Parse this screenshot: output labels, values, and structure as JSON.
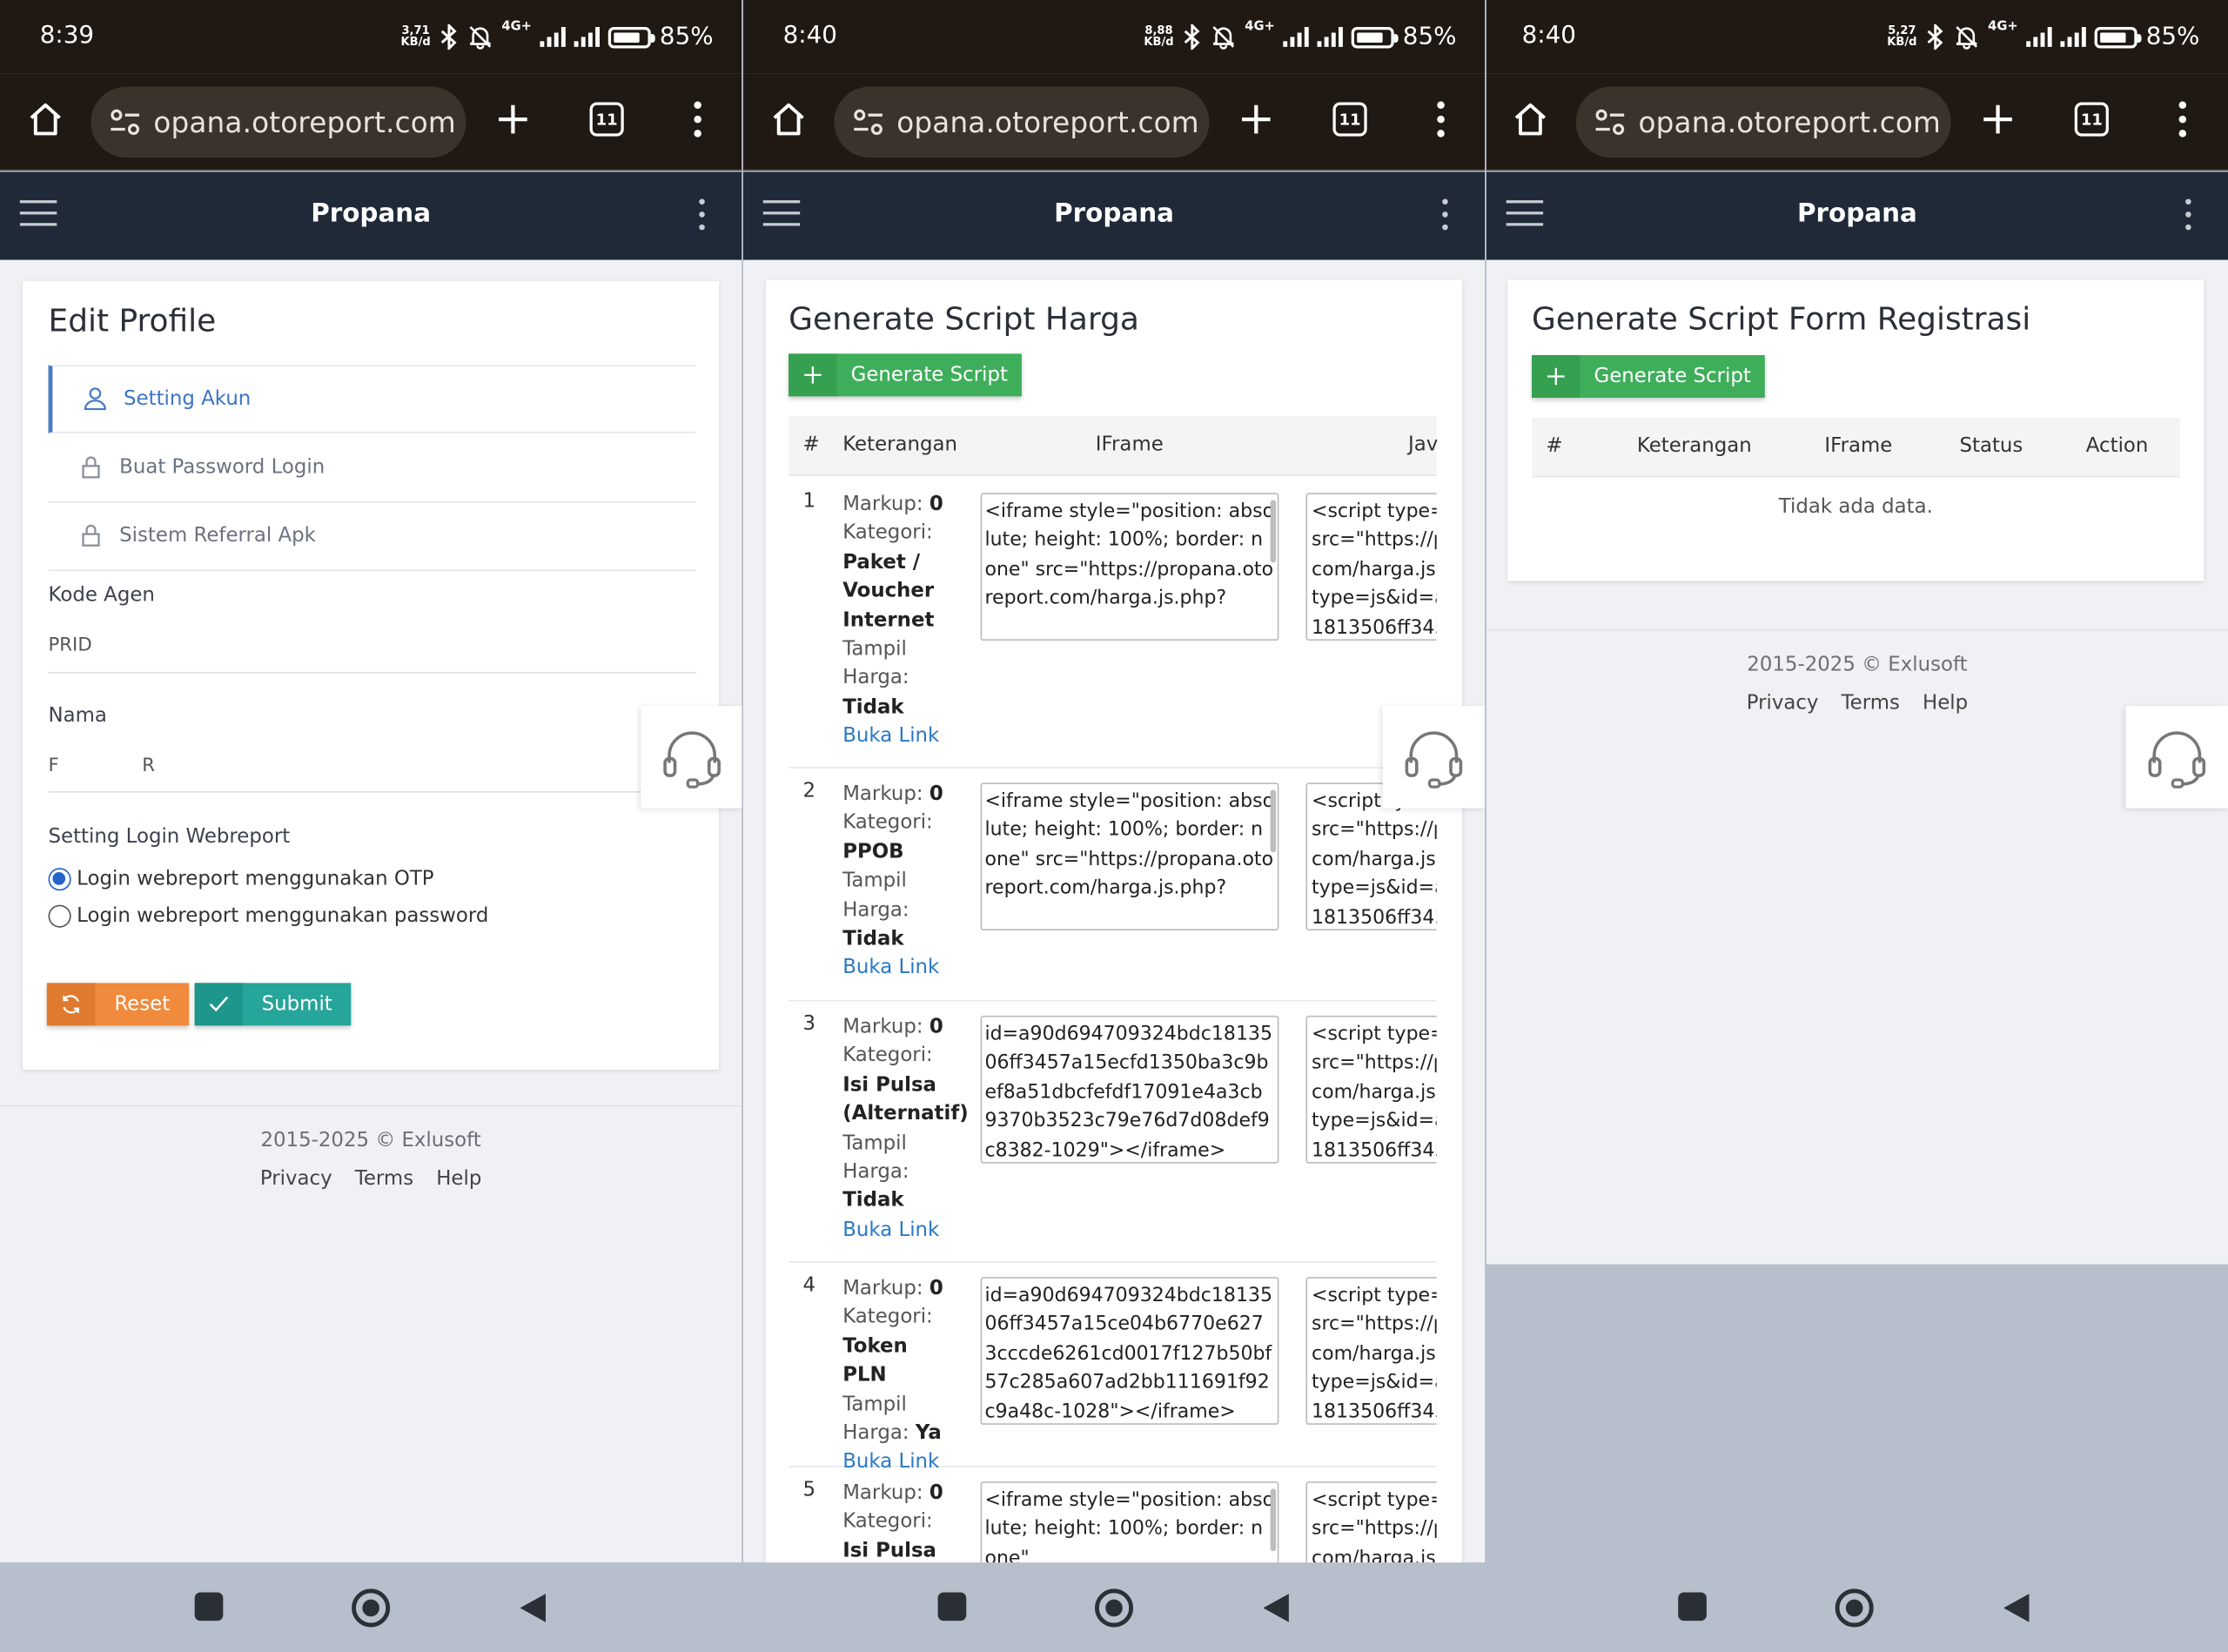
{
  "status": {
    "p1": {
      "time": "8:39",
      "speed": "3,71",
      "unit": "KB/d",
      "net": "4G+",
      "battery": "85%"
    },
    "p2": {
      "time": "8:40",
      "speed": "8,88",
      "unit": "KB/d",
      "net": "4G+",
      "battery": "85%"
    },
    "p3": {
      "time": "8:40",
      "speed": "5,27",
      "unit": "KB/d",
      "net": "4G+",
      "battery": "85%"
    }
  },
  "browser": {
    "url": "opana.otoreport.com",
    "tabs": "11"
  },
  "app": {
    "title": "Propana"
  },
  "profile": {
    "title": "Edit Profile",
    "menu": [
      {
        "label": "Setting Akun"
      },
      {
        "label": "Buat Password Login"
      },
      {
        "label": "Sistem Referral Apk"
      }
    ],
    "kode_label": "Kode Agen",
    "kode_value": "PRID",
    "nama_label": "Nama",
    "nama_first": "F",
    "nama_last": "R",
    "login_label": "Setting Login Webreport",
    "opt_otp": "Login webreport menggunakan OTP",
    "opt_pw": "Login webreport menggunakan password",
    "reset": "Reset",
    "submit": "Submit"
  },
  "harga": {
    "title": "Generate Script Harga",
    "button": "Generate Script",
    "headers": [
      "#",
      "Keterangan",
      "IFrame",
      "Jav"
    ],
    "rows": [
      {
        "num": "1",
        "markup_label": "Markup:",
        "markup": "0",
        "kat_label": "Kategori:",
        "kat": "Paket / Voucher Internet",
        "tampil_label": "Tampil Harga:",
        "tampil": "Tidak",
        "link": "Buka Link",
        "iframe": "<iframe style=\"position: absolute; height: 100%; border: none\" src=\"https://propana.otoreport.com/harga.js.php?",
        "js": "<script type=\"\nsrc=\"https://pr\ncom/harga.js.\ntype=js&id=a9\n1813506ff345"
      },
      {
        "num": "2",
        "markup_label": "Markup:",
        "markup": "0",
        "kat_label": "Kategori:",
        "kat": "PPOB",
        "tampil_label": "Tampil Harga:",
        "tampil": "Tidak",
        "link": "Buka Link",
        "iframe": "<iframe style=\"position: absolute; height: 100%; border: none\" src=\"https://propana.otoreport.com/harga.js.php?",
        "js": "<script ty\nsrc=\"https://pr\ncom/harga.js.\ntype=js&id=a9\n1813506ff345"
      },
      {
        "num": "3",
        "markup_label": "Markup:",
        "markup": "0",
        "kat_label": "Kategori:",
        "kat": "Isi Pulsa (Alternatif)",
        "tampil_label": "Tampil Harga:",
        "tampil": "Tidak",
        "link": "Buka Link",
        "iframe": "id=a90d694709324bdc1813506ff3457a15ecfd1350ba3c9bef8a51dbcfefdf17091e4a3cb9370b3523c79e76d7d08def9c8382-1029\"></iframe>",
        "js": "<script type=\"\nsrc=\"https://pr\ncom/harga.js.\ntype=js&id=a9\n1813506ff345"
      },
      {
        "num": "4",
        "markup_label": "Markup:",
        "markup": "0",
        "kat_label": "Kategori:",
        "kat": "Token PLN",
        "tampil_label": "Tampil Harga:",
        "tampil": "Ya",
        "link": "Buka Link",
        "iframe": "id=a90d694709324bdc1813506ff3457a15ce04b6770e6273cccde6261cd0017f127b50bf57c285a607ad2bb111691f92c9a48c-1028\"></iframe>",
        "js": "<script type=\"\nsrc=\"https://pr\ncom/harga.js.\ntype=js&id=a9\n1813506ff345"
      },
      {
        "num": "5",
        "markup_label": "Markup:",
        "markup": "0",
        "kat_label": "Kategori:",
        "kat": "Isi Pulsa",
        "tampil_label": "",
        "tampil": "",
        "link": "",
        "iframe": "<iframe style=\"position: absolute; height: 100%; border: none\"",
        "js": "<script type=\"\nsrc=\"https://pr\ncom/harga.js."
      }
    ]
  },
  "registrasi": {
    "title": "Generate Script Form Registrasi",
    "button": "Generate Script",
    "headers": [
      "#",
      "Keterangan",
      "IFrame",
      "Status",
      "Action"
    ],
    "empty": "Tidak ada data."
  },
  "footer": {
    "copy": "2015-2025 © Exlusoft",
    "links": [
      "Privacy",
      "Terms",
      "Help"
    ]
  },
  "colors": {
    "statusbar": "#201913",
    "appbar": "#1f2937",
    "green": "#3fae5b",
    "orange": "#f08a3c",
    "teal": "#26a59a",
    "link": "#2a78c5"
  }
}
